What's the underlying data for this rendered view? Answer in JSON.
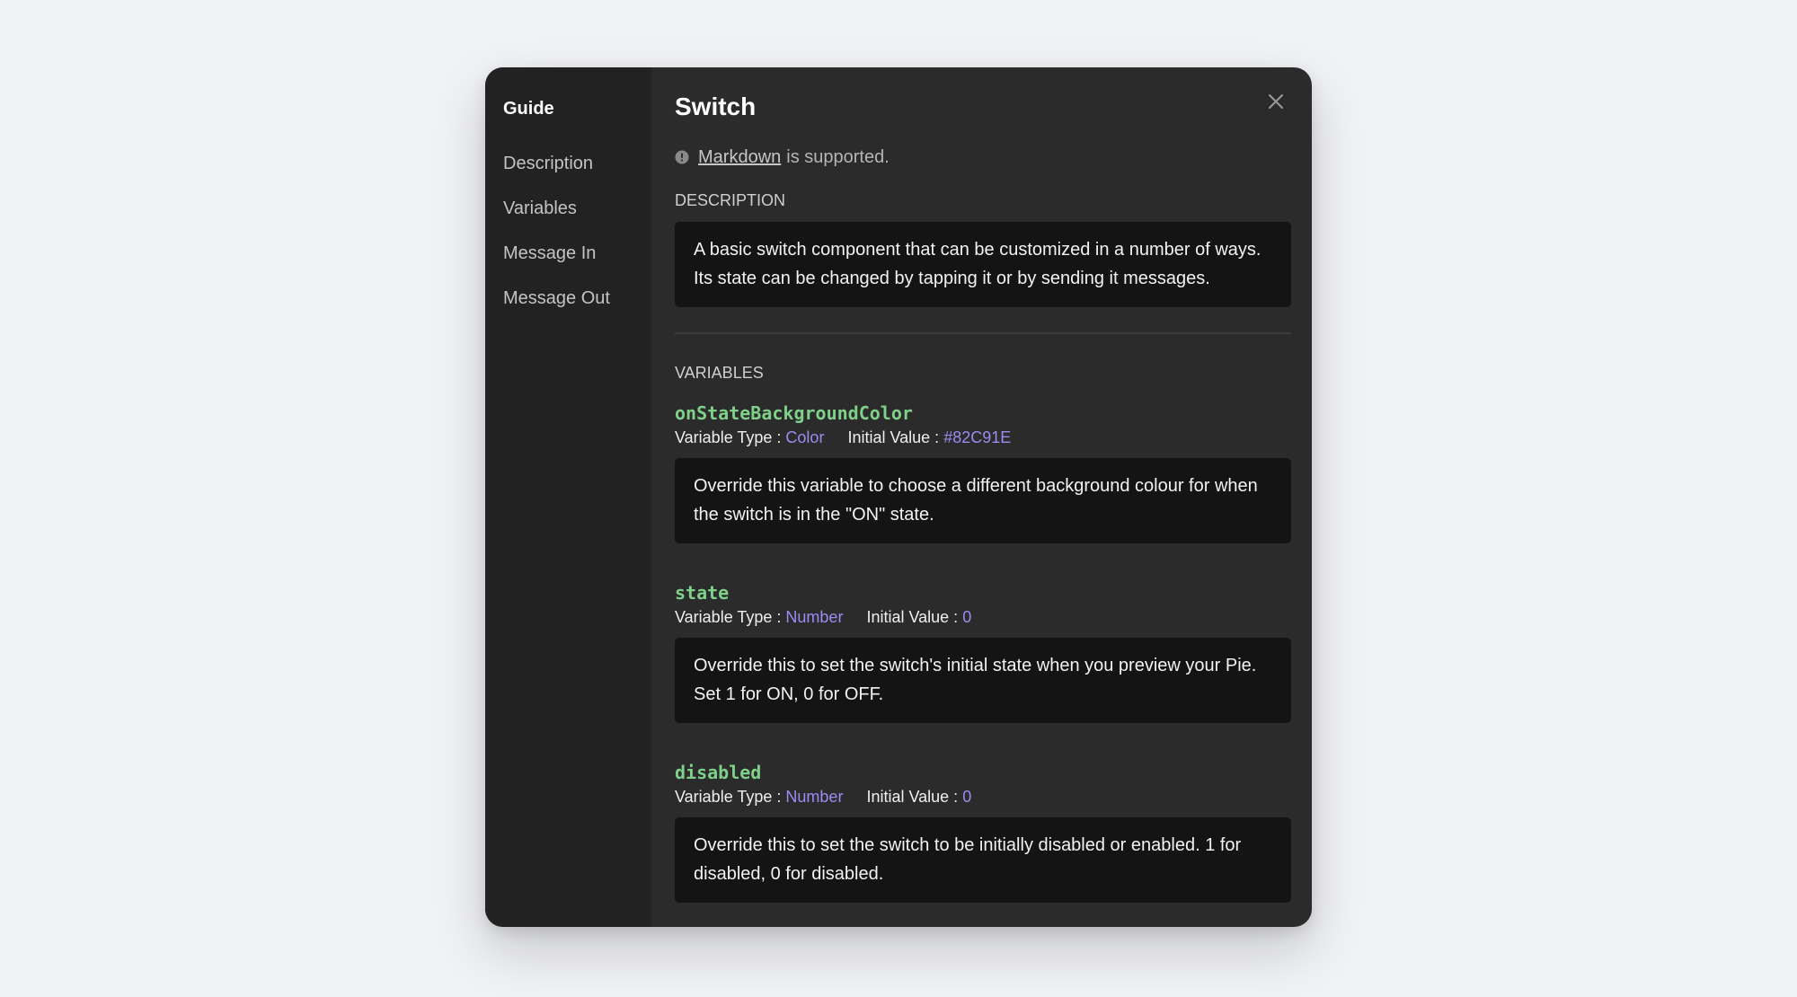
{
  "sidebar": {
    "title": "Guide",
    "items": [
      {
        "label": "Description"
      },
      {
        "label": "Variables"
      },
      {
        "label": "Message In"
      },
      {
        "label": "Message Out"
      }
    ]
  },
  "main": {
    "title": "Switch",
    "markdown_link": "Markdown",
    "markdown_rest": "is supported.",
    "description_heading": "DESCRIPTION",
    "description_text": "A basic switch component that can be customized in a number of ways. Its state can be changed by tapping it or by sending it messages.",
    "variables_heading": "VARIABLES",
    "type_label": "Variable Type :",
    "initial_label": "Initial Value :",
    "variables": [
      {
        "name": "onStateBackgroundColor",
        "type": "Color",
        "initial": "#82C91E",
        "description": "Override this variable to choose a different background colour for when the switch is in the \"ON\" state."
      },
      {
        "name": "state",
        "type": "Number",
        "initial": "0",
        "description": "Override this to set the switch's initial state when you preview your Pie. Set 1 for ON, 0 for OFF."
      },
      {
        "name": "disabled",
        "type": "Number",
        "initial": "0",
        "description": "Override this to set the switch to be initially disabled or enabled. 1 for disabled, 0 for disabled."
      }
    ]
  },
  "icons": {
    "close": "close-icon",
    "info": "info-icon"
  },
  "colors": {
    "page_bg": "#f1f2f6",
    "modal_bg": "#2b2b2b",
    "sidebar_bg": "#222222",
    "box_bg": "#141414",
    "var_name": "#7fd18a",
    "accent": "#9b8cf2"
  }
}
